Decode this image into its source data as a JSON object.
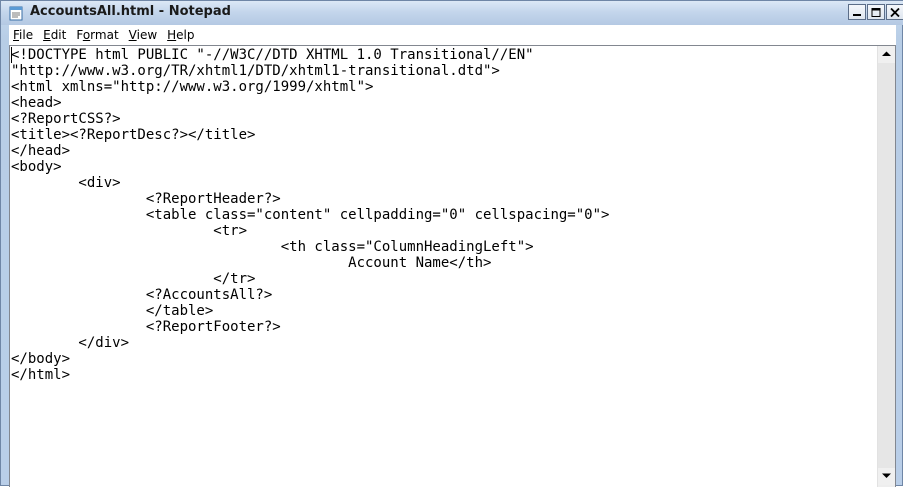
{
  "window": {
    "title": "AccountsAll.html - Notepad"
  },
  "menu": [
    {
      "acc": "F",
      "rest": "ile"
    },
    {
      "acc": "E",
      "rest": "dit"
    },
    {
      "pre": "F",
      "acc": "o",
      "rest": "rmat"
    },
    {
      "acc": "V",
      "rest": "iew"
    },
    {
      "acc": "H",
      "rest": "elp"
    }
  ],
  "editor": {
    "lines": [
      "<!DOCTYPE html PUBLIC \"-//W3C//DTD XHTML 1.0 Transitional//EN\"",
      "\"http://www.w3.org/TR/xhtml1/DTD/xhtml1-transitional.dtd\">",
      "<html xmlns=\"http://www.w3.org/1999/xhtml\">",
      "<head>",
      "<?ReportCSS?>",
      "<title><?ReportDesc?></title>",
      "</head>",
      "<body>",
      "        <div>",
      "                <?ReportHeader?>",
      "                <table class=\"content\" cellpadding=\"0\" cellspacing=\"0\">",
      "                        <tr>",
      "                                <th class=\"ColumnHeadingLeft\">",
      "                                        Account Name</th>",
      "                        </tr>",
      "                <?AccountsAll?>",
      "                </table>",
      "                <?ReportFooter?>",
      "        </div>",
      "</body>",
      "</html>"
    ]
  },
  "icons": {
    "app": "notepad-icon",
    "minimize": "minimize-icon",
    "maximize": "maximize-icon",
    "close": "close-icon",
    "scroll_up": "scroll-up-arrow-icon",
    "scroll_down": "scroll-down-arrow-icon"
  },
  "colors": {
    "titlebar": "#c4d6ec",
    "editor_bg": "#ffffff",
    "text": "#000000"
  }
}
